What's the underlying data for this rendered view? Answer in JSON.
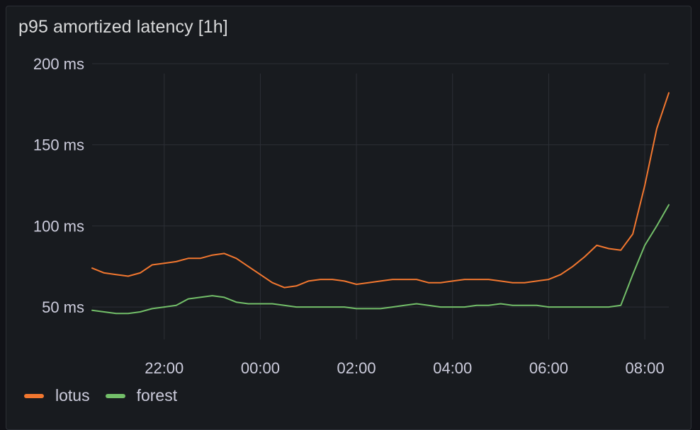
{
  "panel": {
    "title": "p95 amortized latency [1h]"
  },
  "colors": {
    "background": "#181b1f",
    "grid": "#2c2f36",
    "lotus": "#f2772f",
    "forest": "#73bf69"
  },
  "chart_data": {
    "type": "line",
    "title": "p95 amortized latency [1h]",
    "xlabel": "",
    "ylabel": "",
    "y_unit": "ms",
    "ylim": [
      30,
      200
    ],
    "y_ticks": [
      50,
      100,
      150,
      200
    ],
    "y_tick_labels": [
      "50 ms",
      "100 ms",
      "150 ms",
      "200 ms"
    ],
    "xlim": [
      "20:30",
      "08:30"
    ],
    "x_ticks": [
      "22:00",
      "00:00",
      "02:00",
      "04:00",
      "06:00",
      "08:00"
    ],
    "grid": true,
    "legend_position": "bottom-left",
    "series": [
      {
        "name": "lotus",
        "color": "#f2772f",
        "x": [
          "20:30",
          "20:45",
          "21:00",
          "21:15",
          "21:30",
          "21:45",
          "22:00",
          "22:15",
          "22:30",
          "22:45",
          "23:00",
          "23:15",
          "23:30",
          "23:45",
          "00:00",
          "00:15",
          "00:30",
          "00:45",
          "01:00",
          "01:15",
          "01:30",
          "01:45",
          "02:00",
          "02:15",
          "02:30",
          "02:45",
          "03:00",
          "03:15",
          "03:30",
          "03:45",
          "04:00",
          "04:15",
          "04:30",
          "04:45",
          "05:00",
          "05:15",
          "05:30",
          "05:45",
          "06:00",
          "06:15",
          "06:30",
          "06:45",
          "07:00",
          "07:15",
          "07:30",
          "07:45",
          "08:00",
          "08:15",
          "08:30"
        ],
        "values": [
          74,
          71,
          70,
          69,
          71,
          76,
          77,
          78,
          80,
          80,
          82,
          83,
          80,
          75,
          70,
          65,
          62,
          63,
          66,
          67,
          67,
          66,
          64,
          65,
          66,
          67,
          67,
          67,
          65,
          65,
          66,
          67,
          67,
          67,
          66,
          65,
          65,
          66,
          67,
          70,
          75,
          81,
          88,
          86,
          85,
          95,
          125,
          160,
          182
        ]
      },
      {
        "name": "forest",
        "color": "#73bf69",
        "x": [
          "20:30",
          "20:45",
          "21:00",
          "21:15",
          "21:30",
          "21:45",
          "22:00",
          "22:15",
          "22:30",
          "22:45",
          "23:00",
          "23:15",
          "23:30",
          "23:45",
          "00:00",
          "00:15",
          "00:30",
          "00:45",
          "01:00",
          "01:15",
          "01:30",
          "01:45",
          "02:00",
          "02:15",
          "02:30",
          "02:45",
          "03:00",
          "03:15",
          "03:30",
          "03:45",
          "04:00",
          "04:15",
          "04:30",
          "04:45",
          "05:00",
          "05:15",
          "05:30",
          "05:45",
          "06:00",
          "06:15",
          "06:30",
          "06:45",
          "07:00",
          "07:15",
          "07:30",
          "07:45",
          "08:00",
          "08:15",
          "08:30"
        ],
        "values": [
          48,
          47,
          46,
          46,
          47,
          49,
          50,
          51,
          55,
          56,
          57,
          56,
          53,
          52,
          52,
          52,
          51,
          50,
          50,
          50,
          50,
          50,
          49,
          49,
          49,
          50,
          51,
          52,
          51,
          50,
          50,
          50,
          51,
          51,
          52,
          51,
          51,
          51,
          50,
          50,
          50,
          50,
          50,
          50,
          51,
          70,
          88,
          100,
          113
        ]
      }
    ]
  }
}
